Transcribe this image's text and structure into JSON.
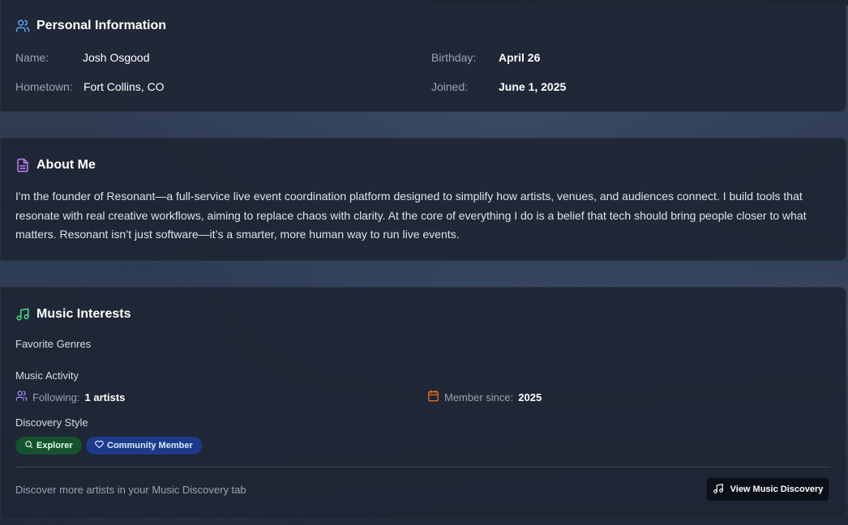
{
  "personal": {
    "title": "Personal Information",
    "name_label": "Name:",
    "name_value": "Josh Osgood",
    "hometown_label": "Hometown:",
    "hometown_value": "Fort Collins, CO",
    "birthday_label": "Birthday:",
    "birthday_value": "April 26",
    "joined_label": "Joined:",
    "joined_value": "June 1, 2025"
  },
  "about": {
    "title": "About Me",
    "text": "I'm the founder of Resonant—a full-service live event coordination platform designed to simplify how artists, venues, and audiences connect. I build tools that resonate with real creative workflows, aiming to replace chaos with clarity. At the core of everything I do is a belief that tech should bring people closer to what matters. Resonant isn’t just software—it’s a smarter, more human way to run live events."
  },
  "music": {
    "title": "Music Interests",
    "favorite_genres_label": "Favorite Genres",
    "activity_label": "Music Activity",
    "following_label": "Following:",
    "following_value": "1 artists",
    "member_since_label": "Member since:",
    "member_since_value": "2025",
    "discovery_style_label": "Discovery Style",
    "chips": [
      {
        "label": "Explorer",
        "icon": "search-icon",
        "color": "#14532d"
      },
      {
        "label": "Community Member",
        "icon": "heart-icon",
        "color": "#1e3a8a"
      }
    ],
    "footer_text": "Discover more artists in your Music Discovery tab",
    "button_label": "View Music Discovery"
  },
  "colors": {
    "users_icon": "#60a5fa",
    "doc_icon": "#c084fc",
    "music_icon": "#4ade80",
    "following_icon": "#a78bfa",
    "calendar_icon": "#f97316"
  }
}
